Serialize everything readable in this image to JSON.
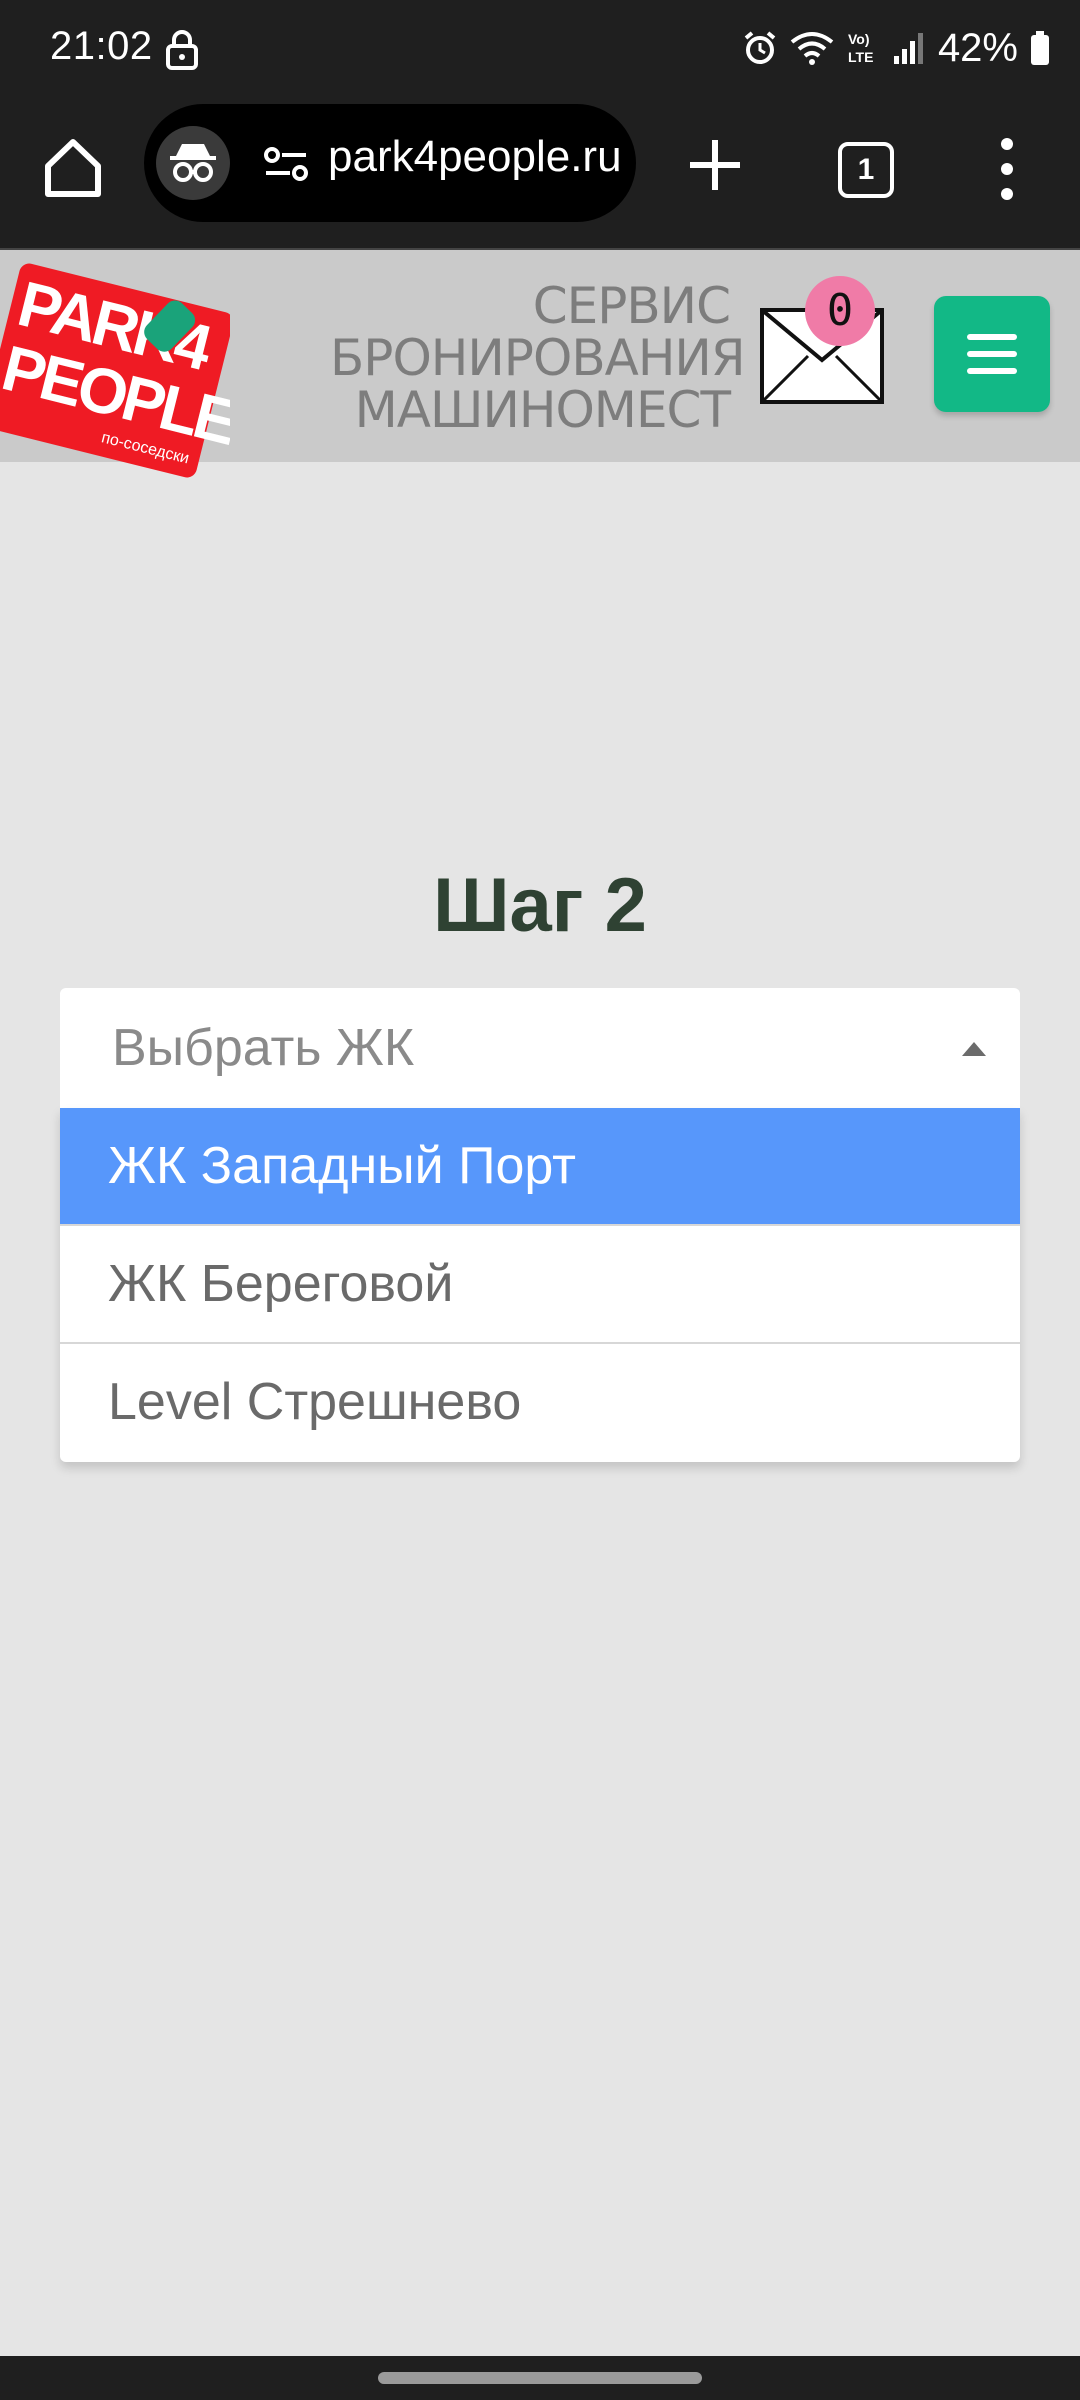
{
  "status_bar": {
    "time": "21:02",
    "battery": "42%",
    "icons": [
      "lock-icon",
      "alarm-icon",
      "wifi-icon",
      "volte-icon",
      "signal-icon",
      "battery-icon"
    ]
  },
  "browser": {
    "url": "park4people.ru",
    "tab_count": "1",
    "icons": [
      "home-icon",
      "incognito-icon",
      "site-settings-icon",
      "new-tab-icon",
      "tabs-icon",
      "more-menu-icon"
    ]
  },
  "site_header": {
    "logo_text_line1": "PARK4",
    "logo_text_line2": "PEOPLE",
    "logo_tagline": "по-соседски",
    "service_line1": "СЕРВИС",
    "service_line2": "БРОНИРОВАНИЯ",
    "service_line3": "МАШИНОМЕСТ",
    "mail_count": "0",
    "colors": {
      "logo_red": "#ef1b24",
      "menu_green": "#12b886",
      "badge_pink": "#f07ba7"
    }
  },
  "main": {
    "step_title": "Шаг 2",
    "select": {
      "placeholder": "Выбрать ЖК",
      "options": [
        "ЖК Западный Порт",
        "ЖК Береговой",
        "Level Стрешнево"
      ],
      "highlighted_index": 0
    },
    "colors": {
      "highlight": "#5797fb",
      "title": "#2f4233"
    }
  }
}
